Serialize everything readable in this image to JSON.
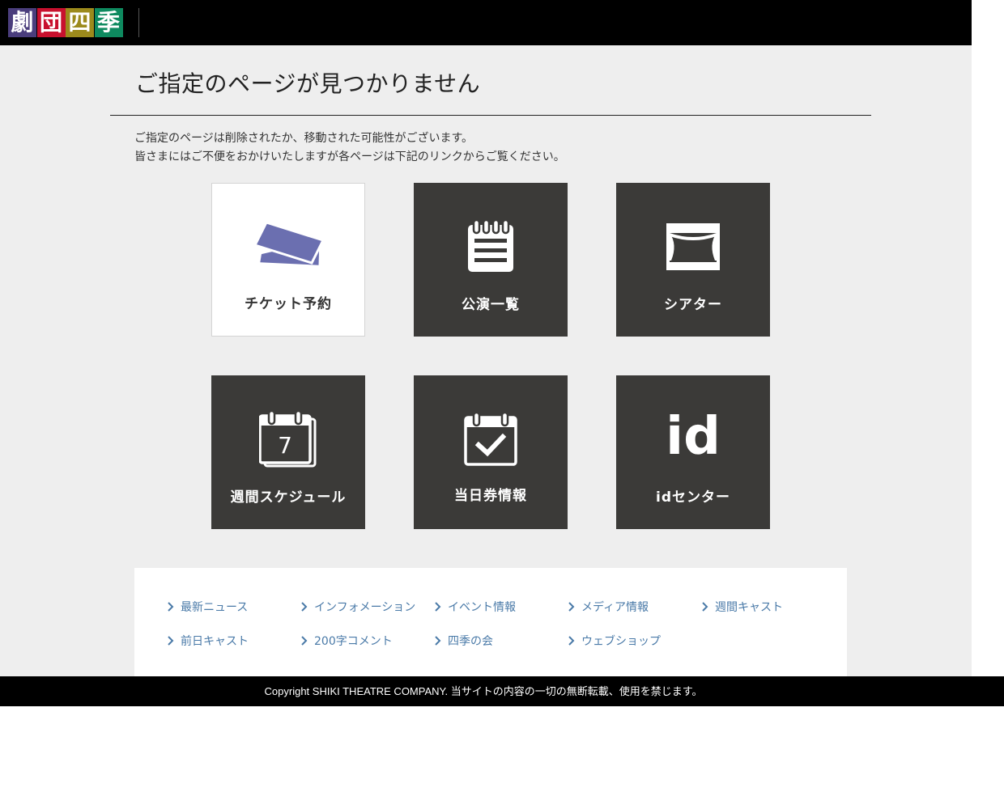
{
  "header": {
    "logo_chars": [
      "劇",
      "団",
      "四",
      "季"
    ],
    "logo_colors": [
      "#4a3d7c",
      "#c8102e",
      "#9c8a1c",
      "#0e8a5f"
    ]
  },
  "main": {
    "title": "ご指定のページが見つかりません",
    "description": [
      "ご指定のページは削除されたか、移動された可能性がございます。",
      "皆さまにはご不便をおかけいたしますが各ページは下記のリンクからご覧ください。"
    ],
    "tiles": [
      {
        "label": "チケット予約",
        "icon": "ticket-icon"
      },
      {
        "label": "公演一覧",
        "icon": "notepad-icon"
      },
      {
        "label": "シアター",
        "icon": "stage-curtain-icon"
      },
      {
        "label": "週間スケジュール",
        "icon": "calendar-7-icon",
        "icon_text": "7"
      },
      {
        "label": "当日券情報",
        "icon": "calendar-check-icon"
      },
      {
        "label": "idセンター",
        "icon": "id-icon",
        "icon_text": "id"
      }
    ]
  },
  "links": [
    "最新ニュース",
    "インフォメーション",
    "イベント情報",
    "メディア情報",
    "週間キャスト",
    "前日キャスト",
    "200字コメント",
    "四季の会",
    "ウェブショップ"
  ],
  "footer": {
    "copyright": "Copyright SHIKI THEATRE COMPANY. 当サイトの内容の一切の無断転載、使用を禁じます。"
  },
  "colors": {
    "tile_dark": "#3b3a38",
    "ticket_blue": "#6b6fb0",
    "link_blue": "#4a7aa8",
    "background": "#eeeeee"
  }
}
